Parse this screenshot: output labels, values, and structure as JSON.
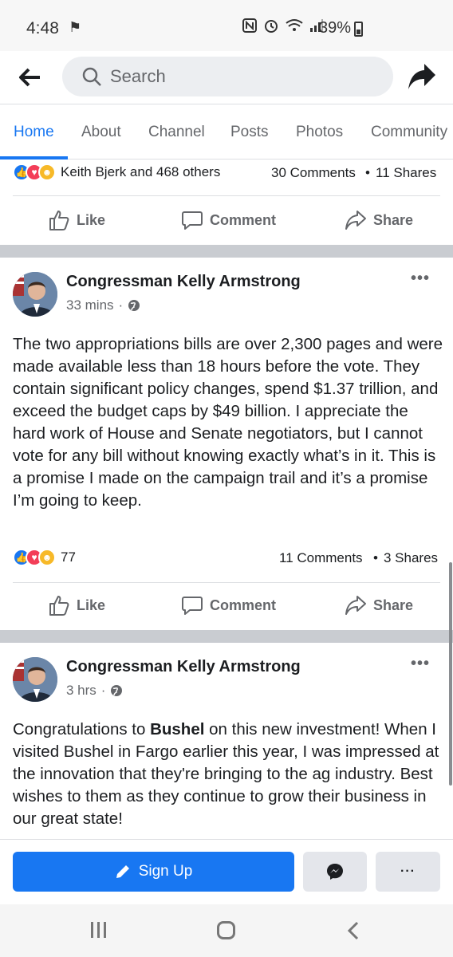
{
  "status_bar": {
    "time": "4:48",
    "battery": "39%"
  },
  "header": {
    "search_placeholder": "Search"
  },
  "tabs": [
    {
      "label": "Home",
      "active": true
    },
    {
      "label": "About"
    },
    {
      "label": "Channel"
    },
    {
      "label": "Posts"
    },
    {
      "label": "Photos"
    },
    {
      "label": "Community"
    }
  ],
  "prev_post": {
    "reactions_text": "Keith Bjerk and 468 others",
    "comments": "30 Comments",
    "shares": "11 Shares"
  },
  "actions": {
    "like": "Like",
    "comment": "Comment",
    "share": "Share"
  },
  "post1": {
    "author": "Congressman Kelly Armstrong",
    "time": "33 mins",
    "text": "The two appropriations bills are over 2,300 pages and were made available less than 18 hours before the vote. They contain significant policy changes, spend $1.37 trillion, and exceed the budget caps by $49 billion. I appreciate the hard work of House and Senate negotiators, but I cannot vote for any bill without knowing exactly what’s in it. This is a promise I made on the campaign trail and it’s a promise I’m going to keep.",
    "reactions_count": "77",
    "comments": "11 Comments",
    "shares": "3 Shares"
  },
  "post2": {
    "author": "Congressman Kelly Armstrong",
    "time": "3 hrs",
    "text_pre": "Congratulations to ",
    "text_bold": "Bushel",
    "text_post": " on this new investment! When I visited Bushel in Fargo earlier this year, I was impressed at the innovation that they're bringing to the ag industry. Best wishes to them as they continue to grow their business in our great state!"
  },
  "bottom_bar": {
    "signup_label": "Sign Up",
    "more_label": "···"
  },
  "colors": {
    "brand_blue": "#1877f2",
    "separator_gray": "#c9ccd1",
    "secondary_text": "#65676b"
  }
}
